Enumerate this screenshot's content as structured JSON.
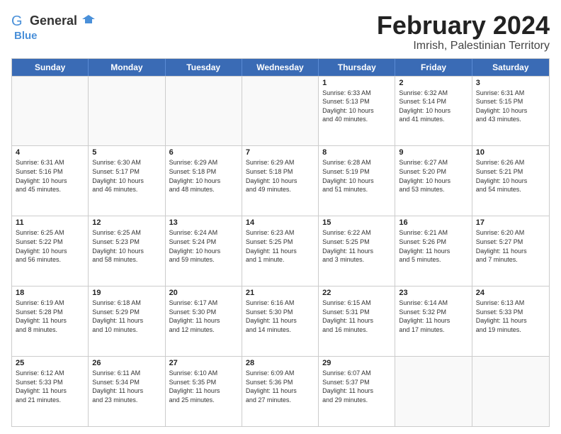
{
  "logo": {
    "general": "General",
    "blue": "Blue"
  },
  "title": "February 2024",
  "subtitle": "Imrish, Palestinian Territory",
  "header_days": [
    "Sunday",
    "Monday",
    "Tuesday",
    "Wednesday",
    "Thursday",
    "Friday",
    "Saturday"
  ],
  "rows": [
    [
      {
        "day": "",
        "info": "",
        "empty": true
      },
      {
        "day": "",
        "info": "",
        "empty": true
      },
      {
        "day": "",
        "info": "",
        "empty": true
      },
      {
        "day": "",
        "info": "",
        "empty": true
      },
      {
        "day": "1",
        "info": "Sunrise: 6:33 AM\nSunset: 5:13 PM\nDaylight: 10 hours\nand 40 minutes."
      },
      {
        "day": "2",
        "info": "Sunrise: 6:32 AM\nSunset: 5:14 PM\nDaylight: 10 hours\nand 41 minutes."
      },
      {
        "day": "3",
        "info": "Sunrise: 6:31 AM\nSunset: 5:15 PM\nDaylight: 10 hours\nand 43 minutes."
      }
    ],
    [
      {
        "day": "4",
        "info": "Sunrise: 6:31 AM\nSunset: 5:16 PM\nDaylight: 10 hours\nand 45 minutes."
      },
      {
        "day": "5",
        "info": "Sunrise: 6:30 AM\nSunset: 5:17 PM\nDaylight: 10 hours\nand 46 minutes."
      },
      {
        "day": "6",
        "info": "Sunrise: 6:29 AM\nSunset: 5:18 PM\nDaylight: 10 hours\nand 48 minutes."
      },
      {
        "day": "7",
        "info": "Sunrise: 6:29 AM\nSunset: 5:18 PM\nDaylight: 10 hours\nand 49 minutes."
      },
      {
        "day": "8",
        "info": "Sunrise: 6:28 AM\nSunset: 5:19 PM\nDaylight: 10 hours\nand 51 minutes."
      },
      {
        "day": "9",
        "info": "Sunrise: 6:27 AM\nSunset: 5:20 PM\nDaylight: 10 hours\nand 53 minutes."
      },
      {
        "day": "10",
        "info": "Sunrise: 6:26 AM\nSunset: 5:21 PM\nDaylight: 10 hours\nand 54 minutes."
      }
    ],
    [
      {
        "day": "11",
        "info": "Sunrise: 6:25 AM\nSunset: 5:22 PM\nDaylight: 10 hours\nand 56 minutes."
      },
      {
        "day": "12",
        "info": "Sunrise: 6:25 AM\nSunset: 5:23 PM\nDaylight: 10 hours\nand 58 minutes."
      },
      {
        "day": "13",
        "info": "Sunrise: 6:24 AM\nSunset: 5:24 PM\nDaylight: 10 hours\nand 59 minutes."
      },
      {
        "day": "14",
        "info": "Sunrise: 6:23 AM\nSunset: 5:25 PM\nDaylight: 11 hours\nand 1 minute."
      },
      {
        "day": "15",
        "info": "Sunrise: 6:22 AM\nSunset: 5:25 PM\nDaylight: 11 hours\nand 3 minutes."
      },
      {
        "day": "16",
        "info": "Sunrise: 6:21 AM\nSunset: 5:26 PM\nDaylight: 11 hours\nand 5 minutes."
      },
      {
        "day": "17",
        "info": "Sunrise: 6:20 AM\nSunset: 5:27 PM\nDaylight: 11 hours\nand 7 minutes."
      }
    ],
    [
      {
        "day": "18",
        "info": "Sunrise: 6:19 AM\nSunset: 5:28 PM\nDaylight: 11 hours\nand 8 minutes."
      },
      {
        "day": "19",
        "info": "Sunrise: 6:18 AM\nSunset: 5:29 PM\nDaylight: 11 hours\nand 10 minutes."
      },
      {
        "day": "20",
        "info": "Sunrise: 6:17 AM\nSunset: 5:30 PM\nDaylight: 11 hours\nand 12 minutes."
      },
      {
        "day": "21",
        "info": "Sunrise: 6:16 AM\nSunset: 5:30 PM\nDaylight: 11 hours\nand 14 minutes."
      },
      {
        "day": "22",
        "info": "Sunrise: 6:15 AM\nSunset: 5:31 PM\nDaylight: 11 hours\nand 16 minutes."
      },
      {
        "day": "23",
        "info": "Sunrise: 6:14 AM\nSunset: 5:32 PM\nDaylight: 11 hours\nand 17 minutes."
      },
      {
        "day": "24",
        "info": "Sunrise: 6:13 AM\nSunset: 5:33 PM\nDaylight: 11 hours\nand 19 minutes."
      }
    ],
    [
      {
        "day": "25",
        "info": "Sunrise: 6:12 AM\nSunset: 5:33 PM\nDaylight: 11 hours\nand 21 minutes."
      },
      {
        "day": "26",
        "info": "Sunrise: 6:11 AM\nSunset: 5:34 PM\nDaylight: 11 hours\nand 23 minutes."
      },
      {
        "day": "27",
        "info": "Sunrise: 6:10 AM\nSunset: 5:35 PM\nDaylight: 11 hours\nand 25 minutes."
      },
      {
        "day": "28",
        "info": "Sunrise: 6:09 AM\nSunset: 5:36 PM\nDaylight: 11 hours\nand 27 minutes."
      },
      {
        "day": "29",
        "info": "Sunrise: 6:07 AM\nSunset: 5:37 PM\nDaylight: 11 hours\nand 29 minutes."
      },
      {
        "day": "",
        "info": "",
        "empty": true
      },
      {
        "day": "",
        "info": "",
        "empty": true
      }
    ]
  ]
}
